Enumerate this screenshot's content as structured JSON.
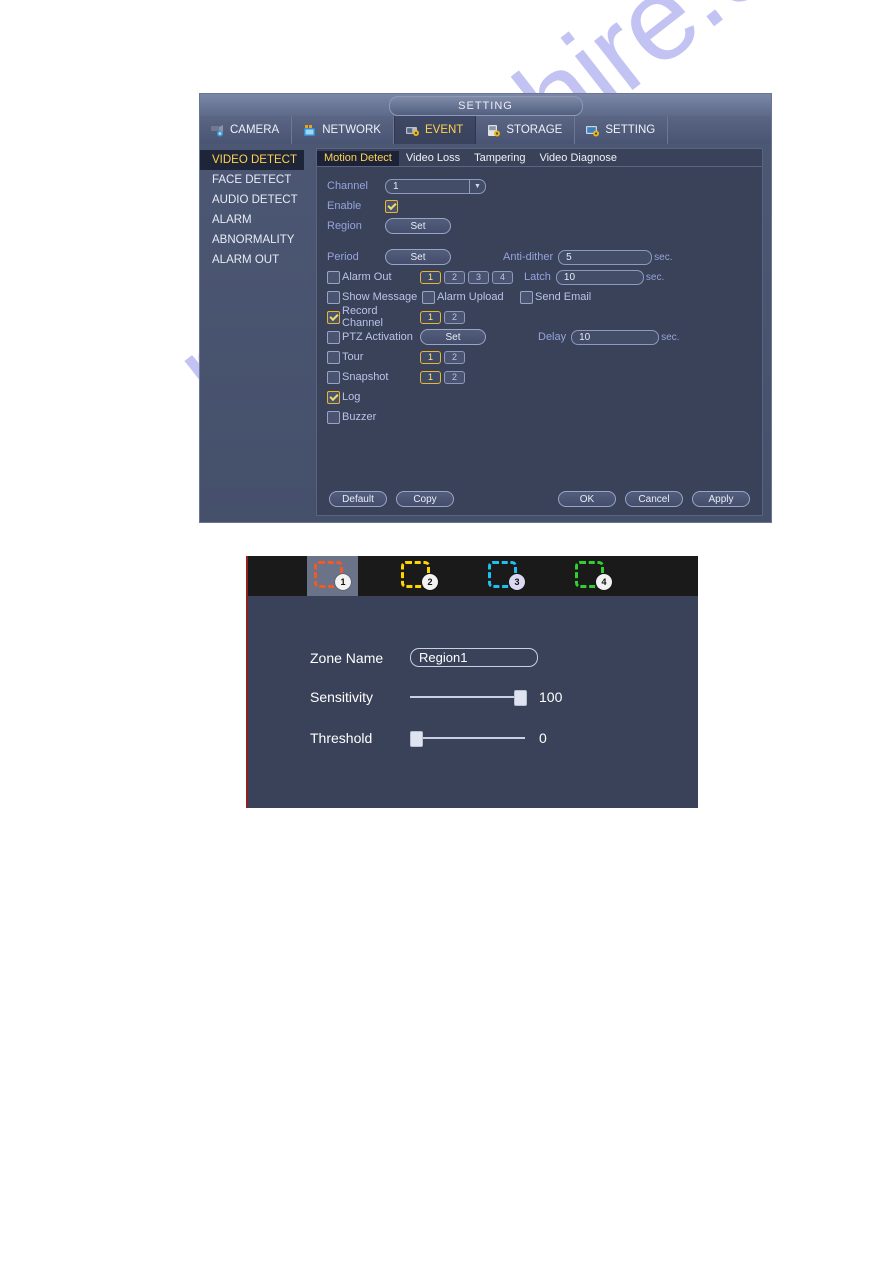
{
  "watermark": "manualshire.com",
  "window": {
    "title": "SETTING",
    "main_tabs": [
      {
        "label": "CAMERA",
        "icon": "camera-icon",
        "active": false
      },
      {
        "label": "NETWORK",
        "icon": "network-icon",
        "active": false
      },
      {
        "label": "EVENT",
        "icon": "event-icon",
        "active": true
      },
      {
        "label": "STORAGE",
        "icon": "storage-icon",
        "active": false
      },
      {
        "label": "SETTING",
        "icon": "setting-icon",
        "active": false
      }
    ],
    "sidebar": [
      {
        "label": "VIDEO DETECT",
        "active": true
      },
      {
        "label": "FACE DETECT",
        "active": false
      },
      {
        "label": "AUDIO DETECT",
        "active": false
      },
      {
        "label": "ALARM",
        "active": false
      },
      {
        "label": "ABNORMALITY",
        "active": false
      },
      {
        "label": "ALARM OUT",
        "active": false
      }
    ],
    "sub_tabs": [
      {
        "label": "Motion Detect",
        "active": true
      },
      {
        "label": "Video Loss",
        "active": false
      },
      {
        "label": "Tampering",
        "active": false
      },
      {
        "label": "Video Diagnose",
        "active": false
      }
    ],
    "form": {
      "channel_label": "Channel",
      "channel_value": "1",
      "enable_label": "Enable",
      "enable_checked": true,
      "region_label": "Region",
      "region_button": "Set",
      "period_label": "Period",
      "period_button": "Set",
      "antidither_label": "Anti-dither",
      "antidither_value": "5",
      "antidither_unit": "sec.",
      "alarm_out_label": "Alarm Out",
      "alarm_out_boxes": [
        "1",
        "2",
        "3",
        "4"
      ],
      "alarm_out_selected": "1",
      "latch_label": "Latch",
      "latch_value": "10",
      "latch_unit": "sec.",
      "show_message_label": "Show Message",
      "alarm_upload_label": "Alarm Upload",
      "send_email_label": "Send Email",
      "record_channel_label": "Record Channel",
      "record_channel_boxes": [
        "1",
        "2"
      ],
      "record_channel_selected": "1",
      "ptz_activation_label": "PTZ Activation",
      "ptz_button": "Set",
      "delay_label": "Delay",
      "delay_value": "10",
      "delay_unit": "sec.",
      "tour_label": "Tour",
      "tour_boxes": [
        "1",
        "2"
      ],
      "tour_selected": "1",
      "snapshot_label": "Snapshot",
      "snapshot_boxes": [
        "1",
        "2"
      ],
      "snapshot_selected": "1",
      "log_label": "Log",
      "buzzer_label": "Buzzer"
    },
    "buttons": {
      "default": "Default",
      "copy": "Copy",
      "ok": "OK",
      "cancel": "Cancel",
      "apply": "Apply"
    }
  },
  "zone_window": {
    "tabs": [
      {
        "number": "1",
        "color": "#f05a28",
        "active": true
      },
      {
        "number": "2",
        "color": "#ffd400",
        "active": false
      },
      {
        "number": "3",
        "color": "#1ec0f0",
        "active": false
      },
      {
        "number": "4",
        "color": "#2fd02f",
        "active": false
      }
    ],
    "zone_name_label": "Zone Name",
    "zone_name_value": "Region1",
    "sensitivity_label": "Sensitivity",
    "sensitivity_value": "100",
    "sensitivity_pct": 100,
    "threshold_label": "Threshold",
    "threshold_value": "0",
    "threshold_pct": 0
  }
}
